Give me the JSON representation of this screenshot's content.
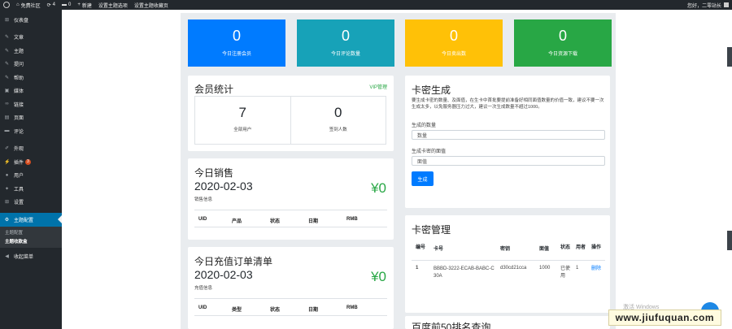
{
  "adminbar": {
    "site_name": "免费社区",
    "updates": "4",
    "comments": "0",
    "new_label": "新建",
    "link1": "设置主题选项",
    "link2": "设置主题收藏页",
    "howdy": "您好，二零站长"
  },
  "sidebar": {
    "items": [
      {
        "icon": "dashboard-icon",
        "glyph": "⊞",
        "label": "仪表盘"
      },
      {
        "icon": "pin-icon",
        "glyph": "✎",
        "label": "文章"
      },
      {
        "icon": "pin-icon",
        "glyph": "✎",
        "label": "主题"
      },
      {
        "icon": "pin-icon",
        "glyph": "✎",
        "label": "提问"
      },
      {
        "icon": "pin-icon",
        "glyph": "✎",
        "label": "帮助"
      },
      {
        "icon": "media-icon",
        "glyph": "▣",
        "label": "媒体"
      },
      {
        "icon": "link-icon",
        "glyph": "∞",
        "label": "链接"
      },
      {
        "icon": "page-icon",
        "glyph": "▤",
        "label": "页面"
      },
      {
        "icon": "comment-icon",
        "glyph": "▬",
        "label": "评论"
      },
      {
        "icon": "appearance-icon",
        "glyph": "✐",
        "label": "外观"
      },
      {
        "icon": "plugin-icon",
        "glyph": "⚡",
        "label": "插件",
        "badge": "3"
      },
      {
        "icon": "user-icon",
        "glyph": "●",
        "label": "用户"
      },
      {
        "icon": "tool-icon",
        "glyph": "✦",
        "label": "工具"
      },
      {
        "icon": "settings-icon",
        "glyph": "⊞",
        "label": "设置"
      },
      {
        "icon": "gear-icon",
        "glyph": "⚙",
        "label": "主题配置"
      }
    ],
    "submenu": [
      "主题配置",
      "主题收款盒"
    ],
    "collapse": {
      "glyph": "◀",
      "label": "收起菜单"
    }
  },
  "stats": [
    {
      "value": "0",
      "label": "今日注册会员",
      "color": "#007bff"
    },
    {
      "value": "0",
      "label": "今日评论数量",
      "color": "#17a2b8"
    },
    {
      "value": "0",
      "label": "今日卖出数",
      "color": "#ffc107"
    },
    {
      "value": "0",
      "label": "今日资源下载",
      "color": "#28a745"
    }
  ],
  "members": {
    "title": "会员统计",
    "vip_link": "VIP管理",
    "all_count": "7",
    "all_label": "全部用户",
    "vip_count": "0",
    "vip_label": "签到人数"
  },
  "sales": {
    "title": "今日销售",
    "date": "2020-02-03",
    "amount": "¥0",
    "note": "销售信息",
    "columns": [
      "UID",
      "产品",
      "状态",
      "日期",
      "RMB"
    ]
  },
  "recharge": {
    "title": "今日充值订单清单",
    "date": "2020-02-03",
    "amount": "¥0",
    "note": "充值信息",
    "columns": [
      "UID",
      "类型",
      "状态",
      "日期",
      "RMB"
    ]
  },
  "cardgen": {
    "title": "卡密生成",
    "desc": "要生成卡密的数量、及面值，在生卡中首批要提前准备好相同面值数量的价值一致，建议不要一次生成太多，以免服务器压力过大，建议一次生成数量不超过1000。",
    "qty_label": "生成的数量",
    "qty_placeholder": "数量",
    "value_label": "生成卡密的面值",
    "value_placeholder": "面值",
    "button": "生成"
  },
  "cardmgmt": {
    "title": "卡密管理",
    "columns": [
      "编号",
      "卡号",
      "密钥",
      "面值",
      "状态",
      "用者",
      "操作"
    ],
    "rows": [
      {
        "id": "1",
        "card": "BBBD-3222-ECAB-BABC-C30A",
        "key": "d30cd21cca",
        "value": "1000",
        "status": "已使用",
        "user": "1",
        "action": "删除"
      }
    ]
  },
  "baidu": {
    "title": "百度前50排名查询"
  },
  "overlay": {
    "windows": "激活 Windows",
    "watermark": "www.jiufuquan.com"
  }
}
